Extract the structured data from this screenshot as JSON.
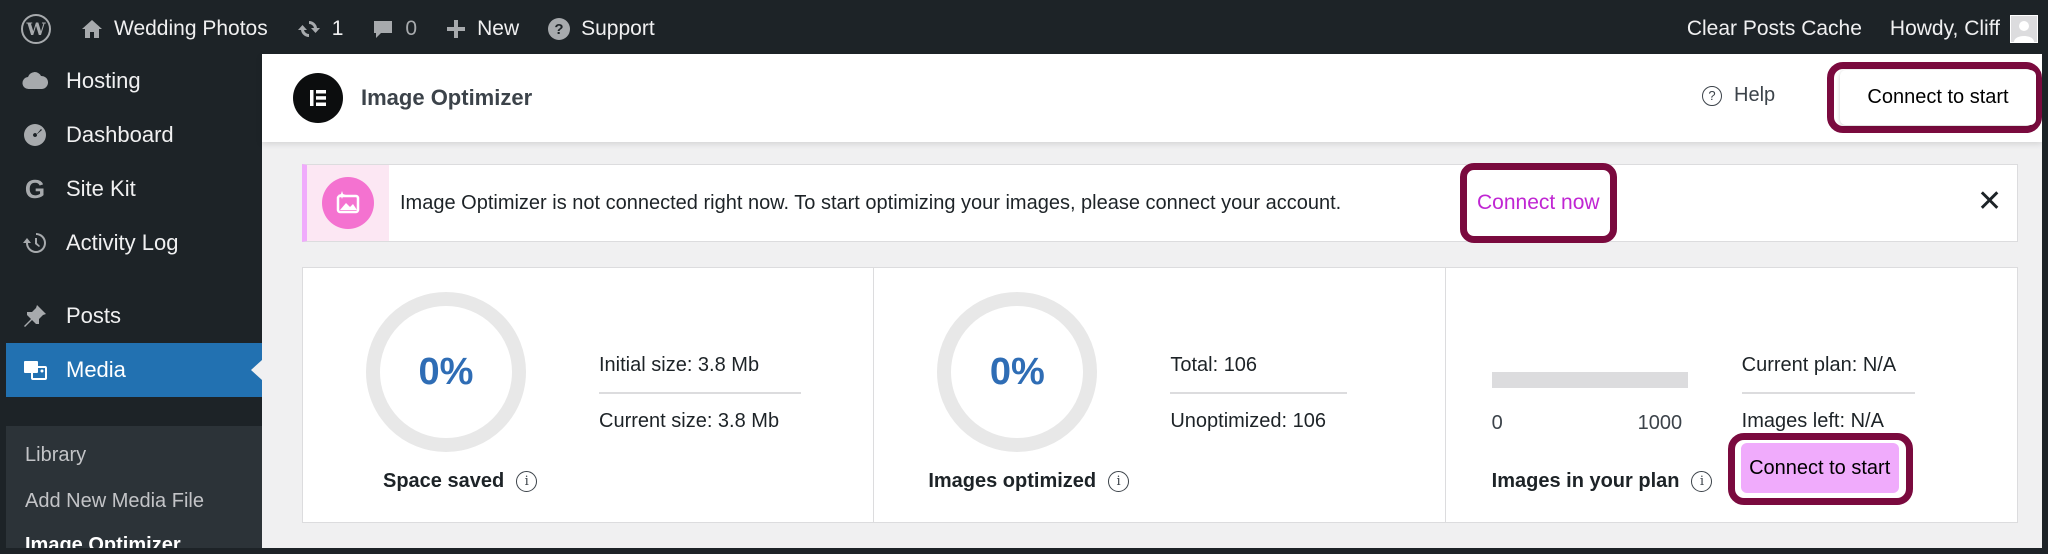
{
  "admin_bar": {
    "site_name": "Wedding Photos",
    "updates_count": "1",
    "comments_count": "0",
    "new_label": "New",
    "support_label": "Support",
    "clear_cache_label": "Clear Posts Cache",
    "howdy_label": "Howdy, Cliff"
  },
  "sidebar": {
    "items": [
      {
        "label": "Hosting",
        "icon": "cloud-icon"
      },
      {
        "label": "Dashboard",
        "icon": "dashboard-icon"
      },
      {
        "label": "Site Kit",
        "icon": "google-g-icon"
      },
      {
        "label": "Activity Log",
        "icon": "history-icon"
      },
      {
        "label": "Posts",
        "icon": "pushpin-icon"
      },
      {
        "label": "Media",
        "icon": "media-icon"
      }
    ],
    "submenu": [
      "Library",
      "Add New Media File",
      "Image Optimizer"
    ]
  },
  "header": {
    "title": "Image Optimizer",
    "help_label": "Help",
    "connect_label": "Connect to start"
  },
  "notice": {
    "text": "Image Optimizer is not connected right now. To start optimizing your images, please connect your account.",
    "link_label": "Connect now",
    "close_glyph": "✕"
  },
  "stats": {
    "space_saved": {
      "value": "0%",
      "label": "Space saved",
      "initial_size": "Initial size: 3.8 Mb",
      "current_size": "Current size: 3.8 Mb"
    },
    "images_optimized": {
      "value": "0%",
      "label": "Images optimized",
      "total": "Total: 106",
      "unoptimized": "Unoptimized: 106"
    },
    "plan": {
      "bar_min": "0",
      "bar_max": "1000",
      "label": "Images in your plan",
      "current_plan": "Current plan: N/A",
      "images_left": "Images left: N/A",
      "connect_label": "Connect to start"
    }
  },
  "colors": {
    "admin_bg": "#1d2327",
    "active_menu": "#2271b1",
    "accent_pink": "#f0abfc",
    "link_magenta": "#c026d3",
    "highlight_ring": "#7a0a3e",
    "stat_value_blue": "#2f6db5"
  }
}
